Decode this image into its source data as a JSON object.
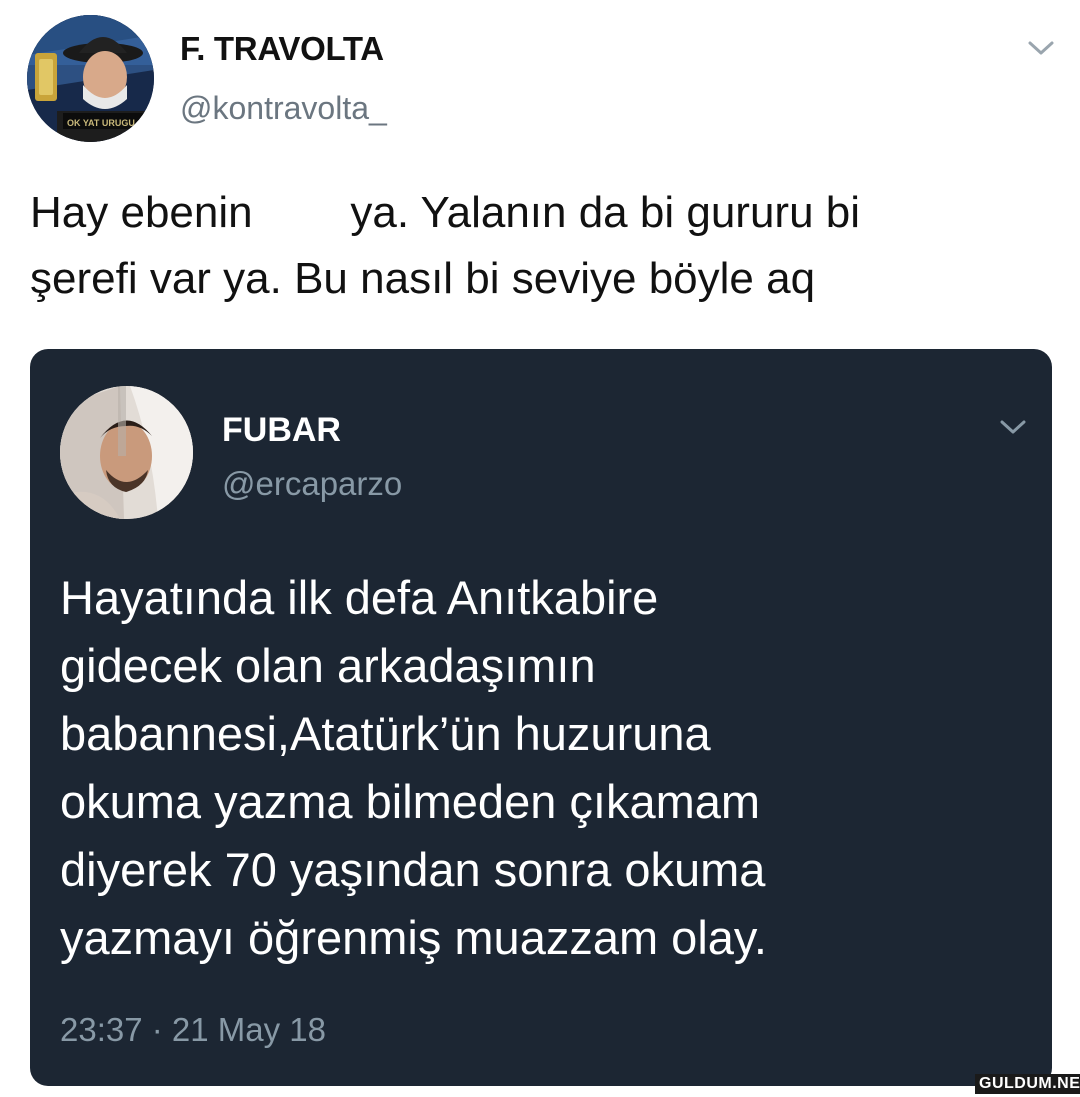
{
  "outer_tweet": {
    "author_name": "F. TRAVOLTA",
    "handle": "@kontravolta_",
    "avatar_badge_text": "OK YAT URUGU",
    "text_lines": [
      "Hay ebenin        ya. Yalanın da bi gururu bi",
      "şerefi var ya. Bu nasıl bi seviye böyle aq"
    ]
  },
  "quoted_tweet": {
    "author_name": "FUBAR",
    "handle": "@ercaparzo",
    "text_lines": [
      "Hayatında ilk defa Anıtkabire",
      "gidecek olan arkadaşımın",
      "babannesi,Atatürk’ün huzuruna",
      "okuma yazma bilmeden çıkamam",
      "diyerek 70 yaşından sonra okuma",
      "yazmayı öğrenmiş muazzam olay."
    ],
    "timestamp": "23:37 · 21 May 18"
  },
  "watermark": "GULDUM.NET",
  "colors": {
    "card_background": "#1c2633",
    "secondary_text_dark": "#8899a6",
    "secondary_text_light": "#6b7680"
  },
  "icons": {
    "outer_menu": "chevron-down-icon",
    "inner_menu": "chevron-down-icon"
  }
}
